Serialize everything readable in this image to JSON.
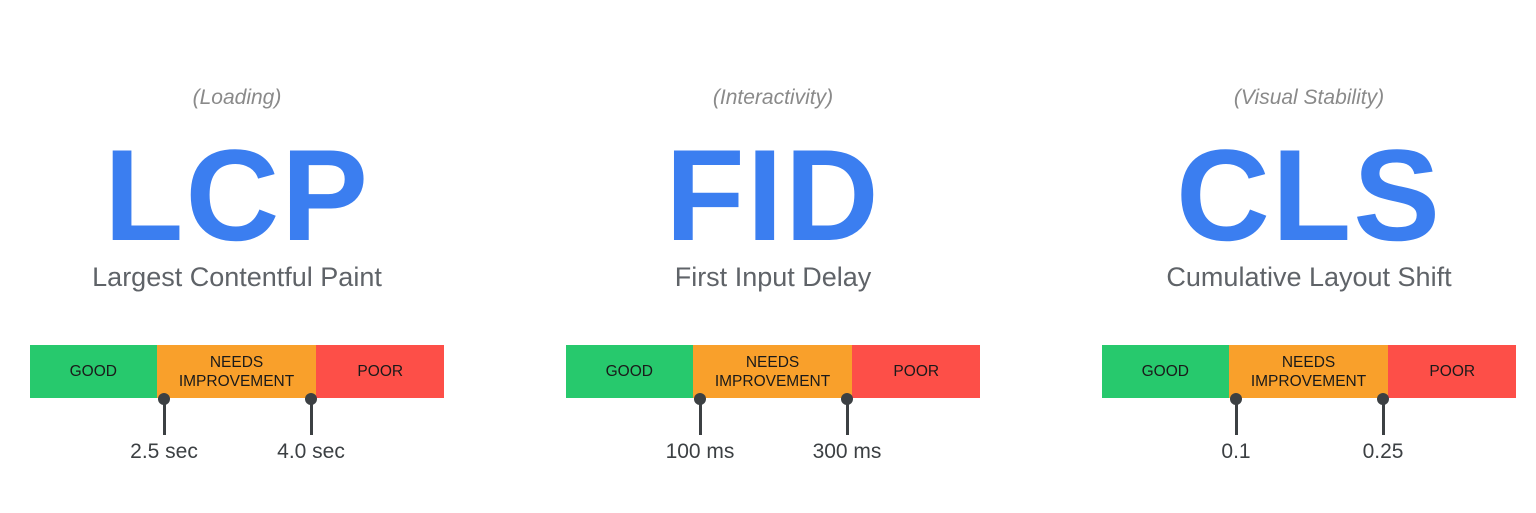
{
  "colors": {
    "good": "#27c96d",
    "needs": "#f9a02b",
    "poor": "#fd4f48",
    "accent": "#3b7ef0"
  },
  "metrics": [
    {
      "category": "(Loading)",
      "abbr": "LCP",
      "name": "Largest Contentful Paint",
      "segments": {
        "good": "GOOD",
        "needs": "NEEDS IMPROVEMENT",
        "poor": "POOR"
      },
      "thresholds": [
        "2.5 sec",
        "4.0 sec"
      ]
    },
    {
      "category": "(Interactivity)",
      "abbr": "FID",
      "name": "First Input Delay",
      "segments": {
        "good": "GOOD",
        "needs": "NEEDS IMPROVEMENT",
        "poor": "POOR"
      },
      "thresholds": [
        "100 ms",
        "300 ms"
      ]
    },
    {
      "category": "(Visual Stability)",
      "abbr": "CLS",
      "name": "Cumulative Layout Shift",
      "segments": {
        "good": "GOOD",
        "needs": "NEEDS IMPROVEMENT",
        "poor": "POOR"
      },
      "thresholds": [
        "0.1",
        "0.25"
      ]
    }
  ]
}
